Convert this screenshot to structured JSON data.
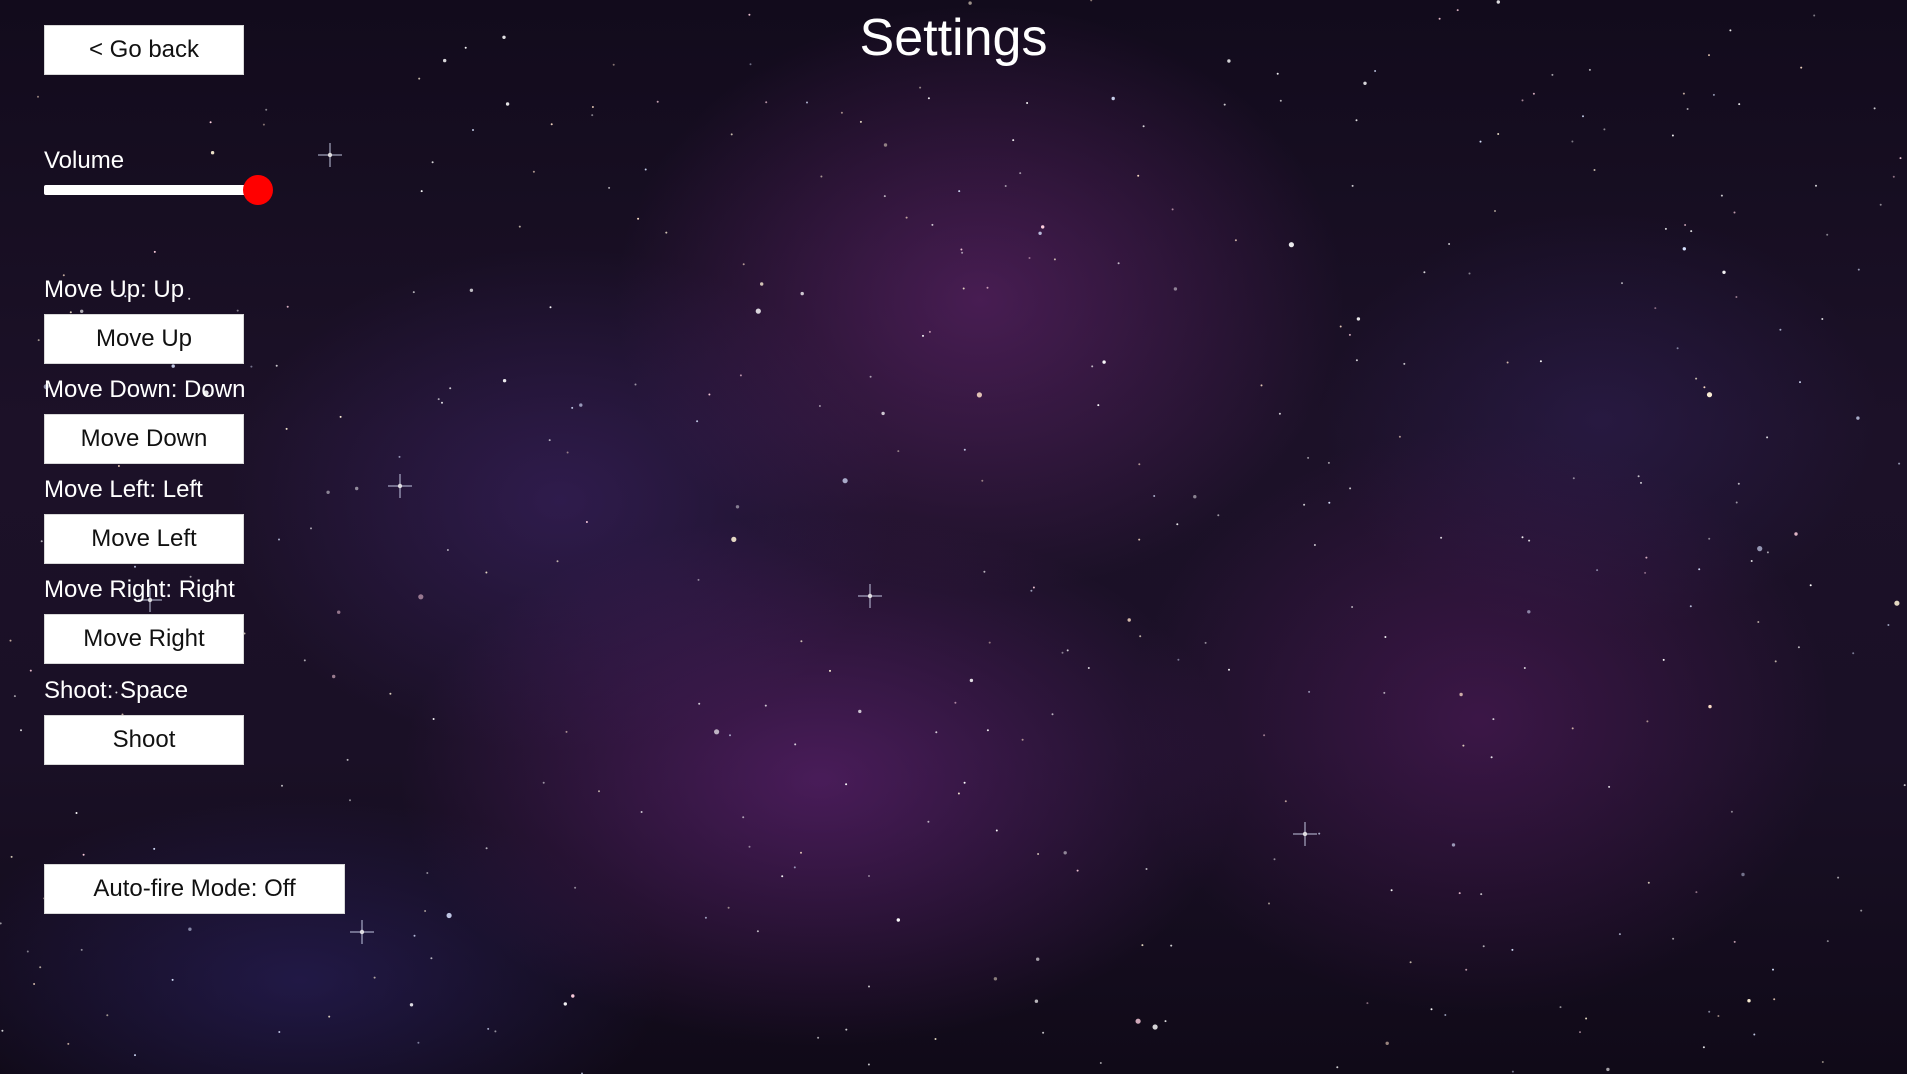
{
  "title": "Settings",
  "back_button": {
    "label": "< Go back"
  },
  "volume": {
    "label": "Volume",
    "value": 1.0
  },
  "bindings": [
    {
      "status": "Move Up: Up",
      "button": "Move Up"
    },
    {
      "status": "Move Down: Down",
      "button": "Move Down"
    },
    {
      "status": "Move Left: Left",
      "button": "Move Left"
    },
    {
      "status": "Move Right: Right",
      "button": "Move Right"
    },
    {
      "status": "Shoot: Space",
      "button": "Shoot"
    }
  ],
  "autofire": {
    "label": "Auto-fire Mode: Off"
  },
  "colors": {
    "slider_thumb": "#ff0000",
    "slider_track": "#ffffff",
    "button_bg": "#ffffff",
    "text": "#ffffff"
  }
}
